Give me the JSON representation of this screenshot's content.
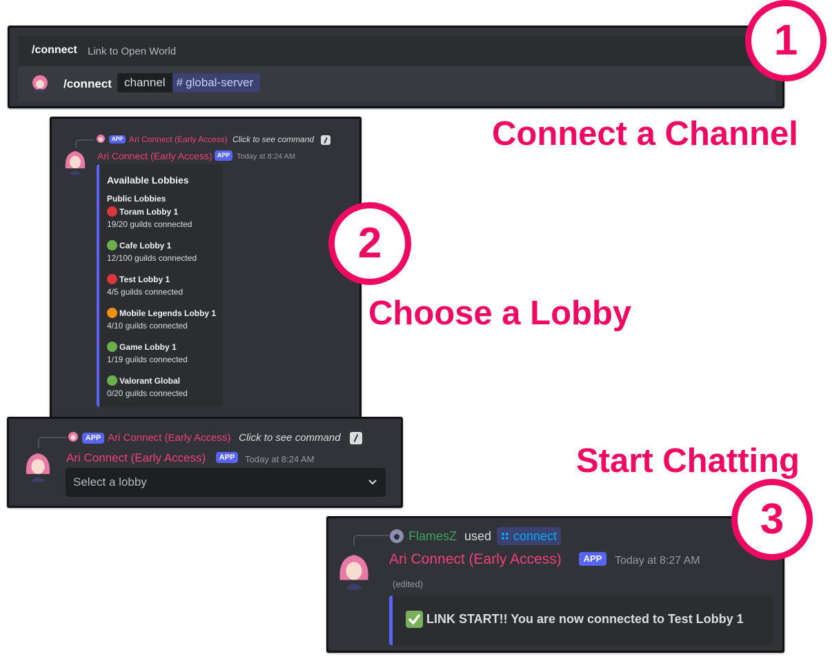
{
  "step1": {
    "command": "/connect",
    "description": "Link to Open World",
    "input_command": "/connect",
    "param_name": "channel",
    "param_value": "global-server",
    "hash": "#"
  },
  "step2": {
    "reply_name": "Ari Connect (Early Access)",
    "reply_hint": "Click to see command",
    "app_tag": "APP",
    "bot_name": "Ari Connect (Early Access)",
    "timestamp": "Today at 8:24 AM",
    "embed_title": "Available Lobbies",
    "section_title": "Public Lobbies",
    "lobbies": [
      {
        "name": "Toram Lobby 1",
        "status": "19/20 guilds connected",
        "color": "#da373c"
      },
      {
        "name": "Cafe Lobby 1",
        "status": "12/100 guilds connected",
        "color": "#6ab04c"
      },
      {
        "name": "Test Lobby 1",
        "status": "4/5 guilds connected",
        "color": "#da373c"
      },
      {
        "name": "Mobile Legends Lobby 1",
        "status": "4/10 guilds connected",
        "color": "#f0900d"
      },
      {
        "name": "Game Lobby 1",
        "status": "1/19 guilds connected",
        "color": "#6ab04c"
      },
      {
        "name": "Valorant Global",
        "status": "0/20 guilds connected",
        "color": "#6ab04c"
      }
    ]
  },
  "step2b": {
    "reply_name": "Ari Connect (Early Access)",
    "reply_hint": "Click to see command",
    "app_tag": "APP",
    "bot_name": "Ari Connect (Early Access)",
    "timestamp": "Today at 8:24 AM",
    "select_placeholder": "Select a lobby"
  },
  "step3": {
    "user": "FlamesZ",
    "used": "used",
    "command": "connect",
    "app_tag": "APP",
    "bot_name": "Ari Connect (Early Access)",
    "timestamp": "Today at 8:27 AM",
    "edited": "(edited)",
    "message": "LINK START!! You are now connected to Test Lobby 1"
  },
  "badges": {
    "one": "1",
    "two": "2",
    "three": "3"
  },
  "captions": {
    "connect": "Connect a Channel",
    "choose": "Choose a Lobby",
    "start": "Start Chatting"
  },
  "colors": {
    "accent": "#ee0a63",
    "discord_bg": "#313338",
    "blurple": "#5865f2",
    "bot_name": "#f23f7e"
  }
}
